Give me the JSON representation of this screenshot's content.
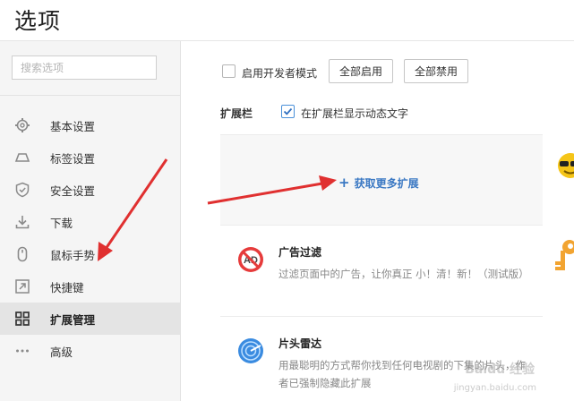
{
  "page": {
    "title": "选项"
  },
  "search": {
    "placeholder": "搜索选项"
  },
  "sidebar": {
    "items": [
      {
        "label": "基本设置",
        "icon": "gear-icon",
        "active": false
      },
      {
        "label": "标签设置",
        "icon": "tab-icon",
        "active": false
      },
      {
        "label": "安全设置",
        "icon": "shield-check-icon",
        "active": false
      },
      {
        "label": "下载",
        "icon": "download-icon",
        "active": false
      },
      {
        "label": "鼠标手势",
        "icon": "mouse-icon",
        "active": false
      },
      {
        "label": "快捷键",
        "icon": "shortcut-icon",
        "active": false
      },
      {
        "label": "扩展管理",
        "icon": "grid-icon",
        "active": true
      },
      {
        "label": "高级",
        "icon": "more-icon",
        "active": false
      }
    ]
  },
  "toolbar": {
    "dev_mode_label": "启用开发者模式",
    "dev_mode_checked": false,
    "enable_all_label": "全部启用",
    "disable_all_label": "全部禁用"
  },
  "extension_bar": {
    "label": "扩展栏",
    "dynamic_text_label": "在扩展栏显示动态文字",
    "dynamic_text_checked": true
  },
  "get_more": {
    "label": "获取更多扩展"
  },
  "extensions": [
    {
      "name": "广告过滤",
      "description": "过滤页面中的广告，让你真正 小！清！新！（测试版）",
      "icon": "ad-block-icon"
    },
    {
      "name": "片头雷达",
      "description": "用最聪明的方式帮你找到任何电视剧的下集的片头，作者已强制隐藏此扩展",
      "icon": "radar-icon"
    }
  ],
  "watermark": {
    "text": "Baidu 经验",
    "url": "jingyan.baidu.com"
  },
  "colors": {
    "accent": "#3a78c3",
    "arrow": "#e03030",
    "active_bg": "#e4e4e4"
  }
}
